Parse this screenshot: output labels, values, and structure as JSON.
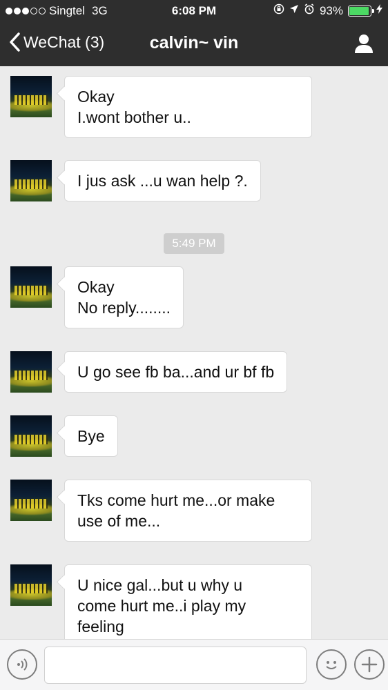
{
  "status_bar": {
    "carrier": "Singtel",
    "network": "3G",
    "time": "6:08 PM",
    "battery_percent": "93%",
    "battery_level": 0.93,
    "signal_bars_filled": 3,
    "signal_bars_total": 5
  },
  "nav": {
    "back_label": "WeChat (3)",
    "title": "calvin~ vin"
  },
  "messages": [
    {
      "text": "Okay\nI.wont bother u.."
    },
    {
      "text": "I jus ask ...u wan help ?."
    },
    {
      "text": "Okay\nNo reply........"
    },
    {
      "text": "U go see fb ba...and ur bf fb"
    },
    {
      "text": "Bye"
    },
    {
      "text": "Tks come hurt me...or make\nuse of me..."
    },
    {
      "text": "U nice gal...but u why u\ncome hurt me..i play my\nfeeling"
    }
  ],
  "timestamp": "5:49 PM",
  "input": {
    "value": "",
    "placeholder": ""
  },
  "icons": {
    "back": "chevron-left-icon",
    "profile": "person-icon",
    "voice": "voice-icon",
    "emoji": "emoji-icon",
    "plus": "plus-icon"
  },
  "colors": {
    "header_bg": "#2e2e2e",
    "chat_bg": "#ebebeb",
    "bubble_bg": "#ffffff",
    "battery_green": "#4cd964"
  }
}
